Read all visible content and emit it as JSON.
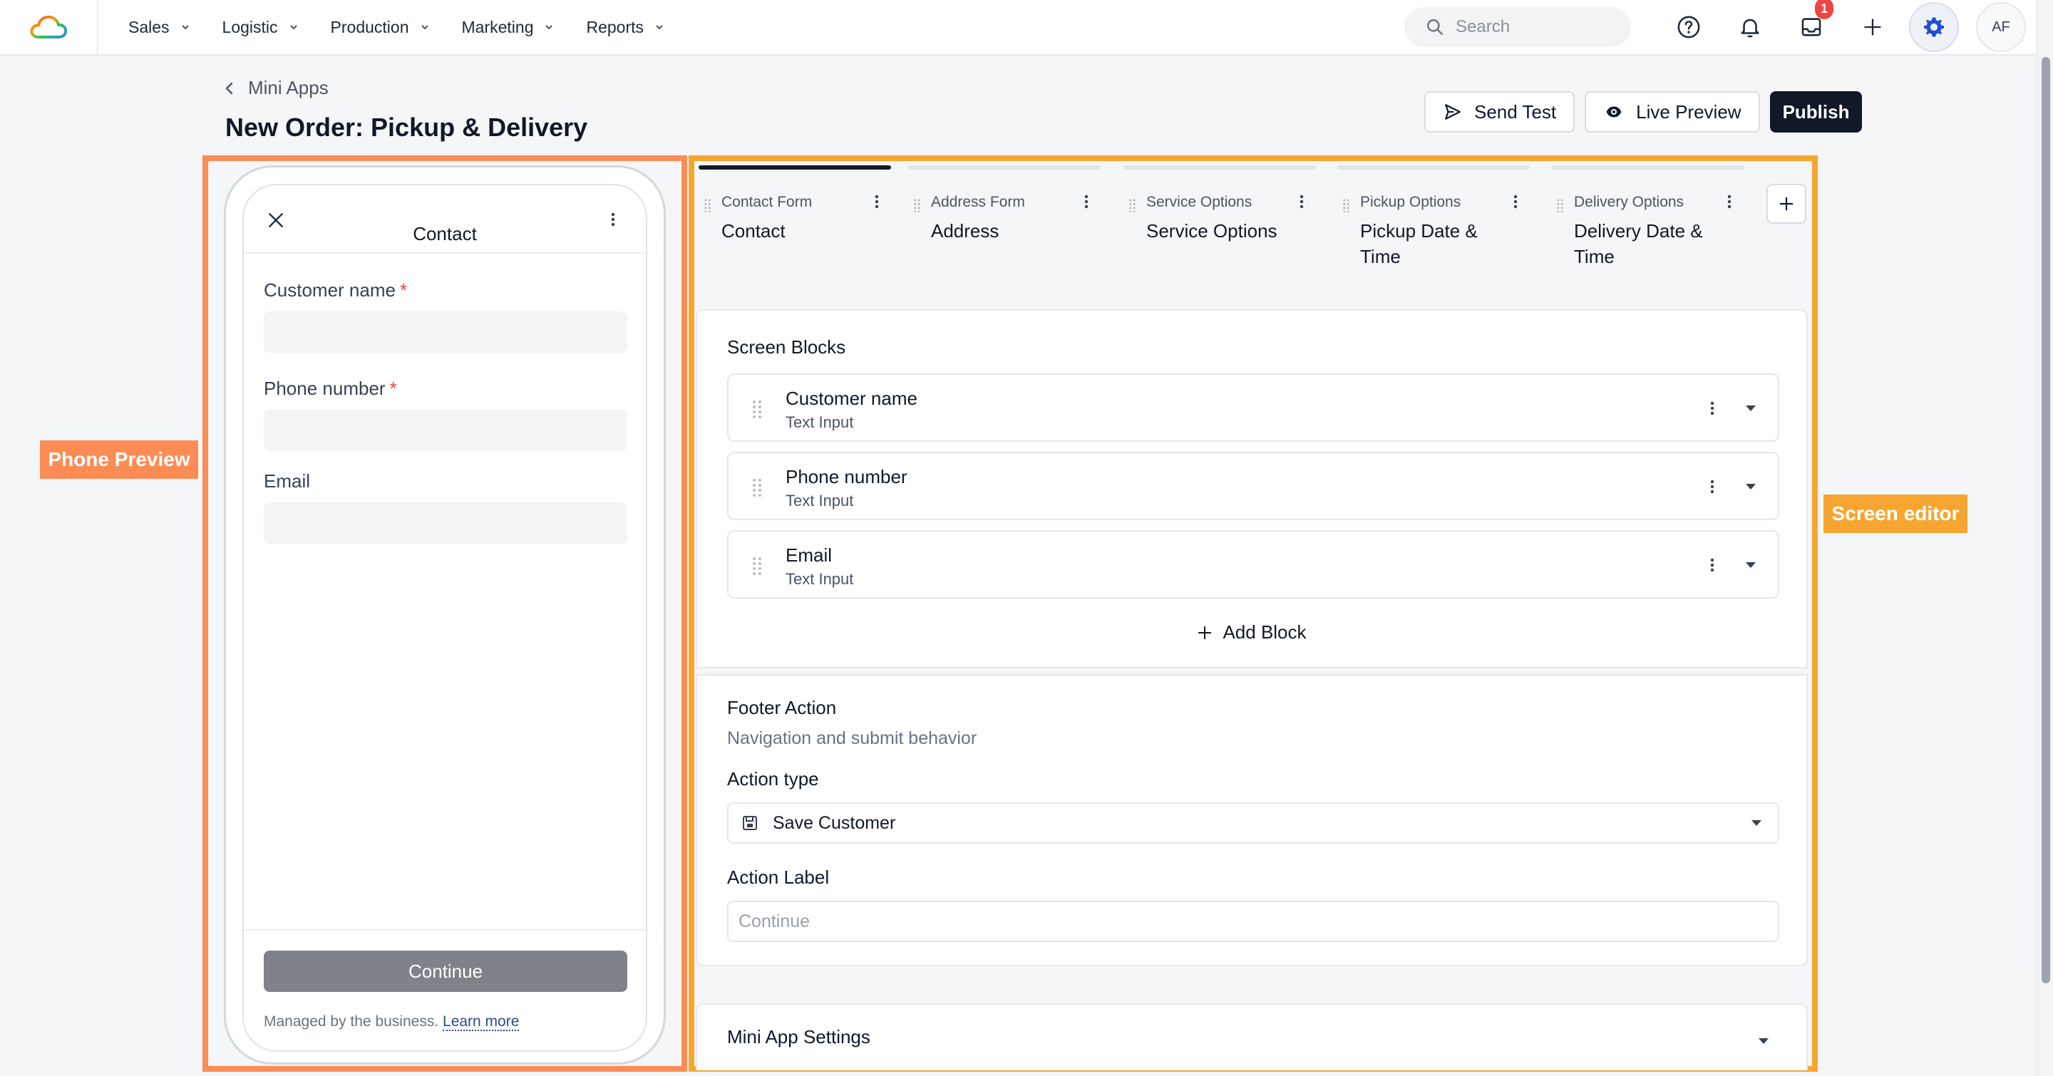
{
  "nav": {
    "items": [
      {
        "label": "Sales"
      },
      {
        "label": "Logistic"
      },
      {
        "label": "Production"
      },
      {
        "label": "Marketing"
      },
      {
        "label": "Reports"
      }
    ],
    "search_placeholder": "Search",
    "inbox_badge": "1",
    "avatar_initials": "AF"
  },
  "header": {
    "breadcrumb": "Mini Apps",
    "title": "New Order: Pickup & Delivery",
    "send_test": "Send Test",
    "live_preview": "Live Preview",
    "publish": "Publish"
  },
  "annotations": {
    "phone_preview": "Phone Preview",
    "screen_editor": "Screen editor"
  },
  "phone": {
    "title": "Contact",
    "fields": [
      {
        "label": "Customer name",
        "required": "*"
      },
      {
        "label": "Phone number",
        "required": "*"
      },
      {
        "label": "Email",
        "required": ""
      }
    ],
    "continue": "Continue",
    "managed_text": "Managed by the business.",
    "learn_more": "Learn more"
  },
  "tabs": [
    {
      "type": "Contact Form",
      "name": "Contact",
      "active": true
    },
    {
      "type": "Address Form",
      "name": "Address",
      "active": false
    },
    {
      "type": "Service Options",
      "name": "Service Options",
      "active": false
    },
    {
      "type": "Pickup Options",
      "name": "Pickup Date & Time",
      "active": false
    },
    {
      "type": "Delivery Options",
      "name": "Delivery Date & Time",
      "active": false
    }
  ],
  "editor": {
    "screen_blocks_title": "Screen Blocks",
    "blocks": [
      {
        "name": "Customer name",
        "type": "Text Input"
      },
      {
        "name": "Phone number",
        "type": "Text Input"
      },
      {
        "name": "Email",
        "type": "Text Input"
      }
    ],
    "add_block": "Add Block",
    "footer_title": "Footer Action",
    "footer_sub": "Navigation and submit behavior",
    "action_type_label": "Action type",
    "action_type_value": "Save Customer",
    "action_label_label": "Action Label",
    "action_label_placeholder": "Continue",
    "settings_title": "Mini App Settings"
  },
  "colors": {
    "brand_dark": "#111827",
    "annotation_orange": "#fb8c55",
    "annotation_yellow": "#f6a630",
    "badge_red": "#ef4444"
  }
}
